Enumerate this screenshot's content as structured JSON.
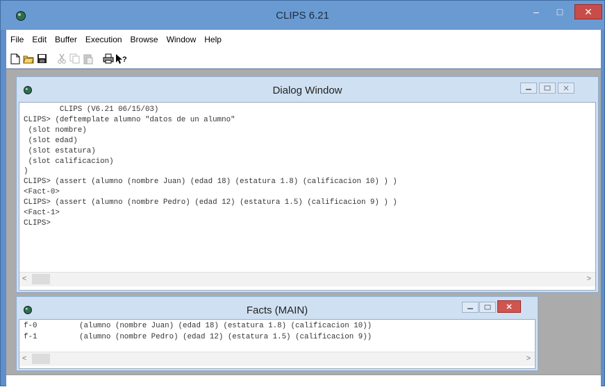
{
  "app": {
    "title": "CLIPS 6.21",
    "controls": {
      "minimize": "–",
      "maximize": "□",
      "close": "✕"
    }
  },
  "menu": [
    "File",
    "Edit",
    "Buffer",
    "Execution",
    "Browse",
    "Window",
    "Help"
  ],
  "toolbar": [
    "new-file-icon",
    "open-folder-icon",
    "save-icon",
    "cut-icon",
    "copy-icon",
    "paste-icon",
    "print-icon",
    "context-help-icon"
  ],
  "dialog": {
    "title": "Dialog Window",
    "lines": [
      "        CLIPS (V6.21 06/15/03)",
      "CLIPS> (deftemplate alumno \"datos de un alumno\"",
      " (slot nombre)",
      " (slot edad)",
      " (slot estatura)",
      " (slot calificacion)",
      ")",
      "CLIPS> (assert (alumno (nombre Juan) (edad 18) (estatura 1.8) (calificacion 10) ) )",
      "<Fact-0>",
      "CLIPS> (assert (alumno (nombre Pedro) (edad 12) (estatura 1.5) (calificacion 9) ) )",
      "<Fact-1>",
      "CLIPS>"
    ],
    "scroll_left": "<",
    "scroll_right": ">"
  },
  "facts": {
    "title": "Facts (MAIN)",
    "rows": [
      {
        "id": "f-0",
        "fact": "(alumno (nombre Juan) (edad 18) (estatura 1.8) (calificacion 10))"
      },
      {
        "id": "f-1",
        "fact": "(alumno (nombre Pedro) (edad 12) (estatura 1.5) (calificacion 9))"
      }
    ],
    "scroll_left": "<",
    "scroll_right": ">"
  },
  "colors": {
    "accent": "#6a9ad2",
    "close": "#c84c47",
    "mdi": "#ababab"
  }
}
